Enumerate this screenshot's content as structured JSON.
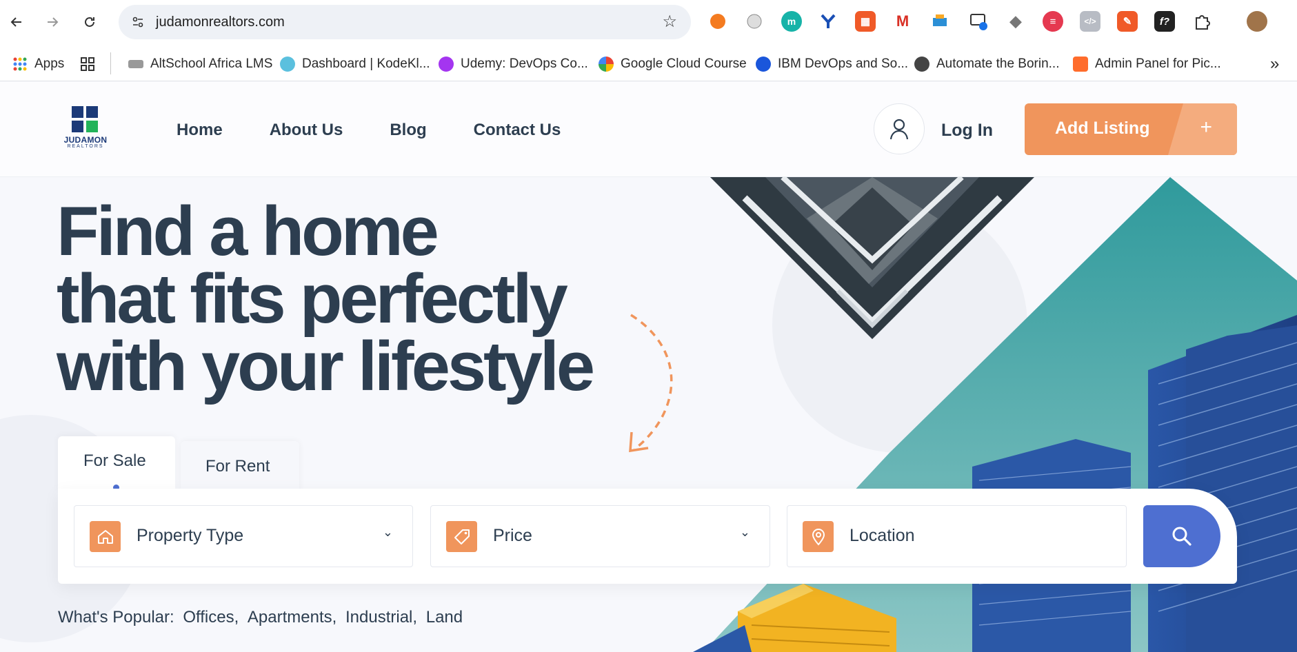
{
  "browser": {
    "url": "judamonrealtors.com",
    "bookmarks": [
      {
        "label": "Apps",
        "icon": "apps-grid-icon"
      },
      {
        "label": "AltSchool Africa LMS",
        "icon": "altschool-icon"
      },
      {
        "label": "Dashboard | KodeKl...",
        "icon": "kodekloud-icon"
      },
      {
        "label": "Udemy: DevOps Co...",
        "icon": "udemy-icon"
      },
      {
        "label": "Google Cloud Course",
        "icon": "google-icon"
      },
      {
        "label": "IBM DevOps and So...",
        "icon": "coursera-icon"
      },
      {
        "label": "Automate the Borin...",
        "icon": "globe-icon"
      },
      {
        "label": "Admin Panel for Pic...",
        "icon": "cpanel-icon"
      }
    ],
    "more_label": "»"
  },
  "site": {
    "logo_text": "JUDAMON",
    "logo_sub": "REALTORS",
    "nav": [
      "Home",
      "About Us",
      "Blog",
      "Contact Us"
    ],
    "login_label": "Log In",
    "add_listing_label": "Add Listing",
    "add_listing_plus": "+"
  },
  "hero": {
    "headline": [
      "Find a home",
      "that fits perfectly",
      "with your lifestyle"
    ],
    "tabs": {
      "sale": "For Sale",
      "rent": "For Rent"
    },
    "fields": {
      "property_type": "Property Type",
      "price": "Price",
      "location": "Location"
    },
    "popular": {
      "label": "What's Popular:",
      "items": [
        "Offices,",
        "Apartments,",
        "Industrial,",
        "Land"
      ]
    }
  },
  "colors": {
    "accent_orange": "#f0955c",
    "accent_blue": "#4e6fd1",
    "heading": "#2d3e50",
    "teal": "#3a9fa0"
  }
}
